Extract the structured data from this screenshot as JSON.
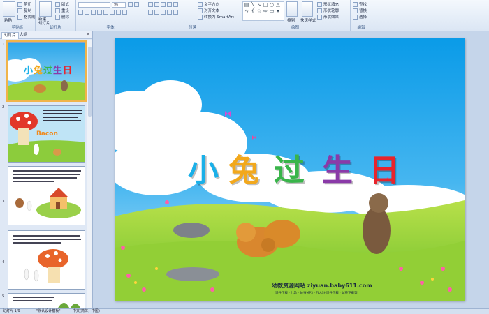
{
  "ribbon": {
    "clipboard": {
      "paste": "粘贴",
      "cut": "剪切",
      "copy": "复制",
      "format_painter": "格式刷",
      "label": "剪贴板"
    },
    "slides": {
      "new_slide": "新建\n幻灯片",
      "layout": "版式",
      "reset": "重设",
      "delete": "删除",
      "label": "幻灯片"
    },
    "font": {
      "size": "96",
      "label": "字体"
    },
    "paragraph": {
      "text_direction": "文字方向",
      "align_text": "对齐文本",
      "convert_smartart": "转换为 SmartArt",
      "label": "段落"
    },
    "drawing": {
      "arrange": "排列",
      "quick_styles": "快速样式",
      "shape_fill": "形状填充",
      "shape_outline": "形状轮廓",
      "shape_effects": "形状效果",
      "label": "绘图"
    },
    "editing": {
      "find": "查找",
      "replace": "替换",
      "select": "选择",
      "label": "编辑"
    }
  },
  "panel": {
    "tabs": [
      "幻灯片",
      "大纲"
    ],
    "close": "×",
    "thumb_numbers": [
      "1",
      "2",
      "3",
      "4",
      "5"
    ]
  },
  "slide": {
    "title_chars": [
      {
        "char": "小",
        "color": "#1ab0e8"
      },
      {
        "char": "兔",
        "color": "#f2a81c"
      },
      {
        "char": "过",
        "color": "#39b54a"
      },
      {
        "char": "生",
        "color": "#8a3aa8"
      },
      {
        "char": "日",
        "color": "#e8242c"
      }
    ],
    "site": "幼教资源网站  ziyuan.baby611.com",
    "site_sub": "课件下载 · 儿歌 · 故事MP3 · FLASH课件下载 · 试卷下载等"
  },
  "status": {
    "slide_pos": "幻灯片 1/9",
    "theme": "\"默认设计模板\"",
    "lang": "中文(简体，中国)"
  }
}
